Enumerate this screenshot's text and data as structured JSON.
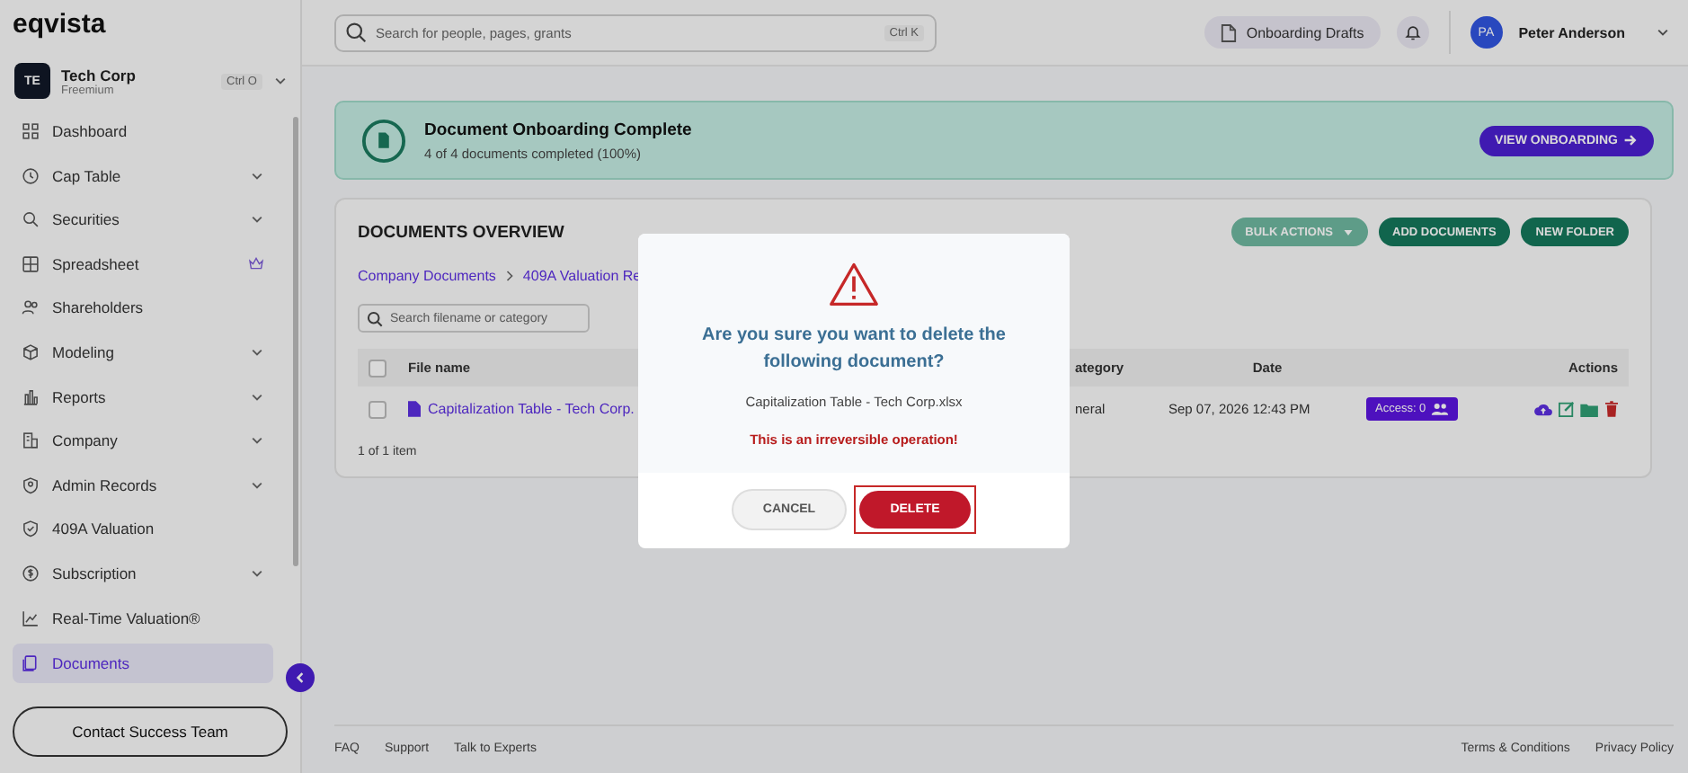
{
  "brand": "eqvista",
  "company": {
    "initials": "TE",
    "name": "Tech Corp",
    "plan": "Freemium",
    "shortcut": "Ctrl O"
  },
  "sidebar": {
    "items": [
      {
        "label": "Dashboard",
        "expandable": false,
        "premium": false,
        "selected": false
      },
      {
        "label": "Cap Table",
        "expandable": true,
        "premium": false,
        "selected": false
      },
      {
        "label": "Securities",
        "expandable": true,
        "premium": false,
        "selected": false
      },
      {
        "label": "Spreadsheet",
        "expandable": false,
        "premium": true,
        "selected": false
      },
      {
        "label": "Shareholders",
        "expandable": false,
        "premium": false,
        "selected": false
      },
      {
        "label": "Modeling",
        "expandable": true,
        "premium": false,
        "selected": false
      },
      {
        "label": "Reports",
        "expandable": true,
        "premium": false,
        "selected": false
      },
      {
        "label": "Company",
        "expandable": true,
        "premium": false,
        "selected": false
      },
      {
        "label": "Admin Records",
        "expandable": true,
        "premium": false,
        "selected": false
      },
      {
        "label": "409A Valuation",
        "expandable": false,
        "premium": false,
        "selected": false
      },
      {
        "label": "Subscription",
        "expandable": true,
        "premium": false,
        "selected": false
      },
      {
        "label": "Real-Time Valuation®",
        "expandable": false,
        "premium": false,
        "selected": false
      },
      {
        "label": "Documents",
        "expandable": false,
        "premium": false,
        "selected": true
      }
    ],
    "contact_button": "Contact Success Team"
  },
  "topbar": {
    "search": {
      "placeholder": "Search for people, pages, grants",
      "shortcut": "Ctrl K"
    },
    "drafts_button": "Onboarding Drafts",
    "user": {
      "initials": "PA",
      "name": "Peter Anderson"
    }
  },
  "banner": {
    "title": "Document Onboarding Complete",
    "subtitle": "4 of 4 documents completed (100%)",
    "button": "VIEW ONBOARDING"
  },
  "documents": {
    "title": "DOCUMENTS OVERVIEW",
    "buttons": [
      "BULK ACTIONS",
      "ADD DOCUMENTS",
      "NEW FOLDER"
    ],
    "breadcrumb": [
      "Company Documents",
      "409A Valuation Re"
    ],
    "search": {
      "placeholder": "Search filename or category"
    },
    "columns": [
      "File name",
      "ategory",
      "Date",
      "Actions"
    ],
    "all_checked": false,
    "rows": [
      {
        "checked": false,
        "file": "Capitalization Table - Tech Corp.",
        "category": "neral",
        "date": "Sep 07, 2026 12:43 PM",
        "access": "Access: 0"
      }
    ],
    "count": "1 of 1 item"
  },
  "footer": {
    "links": [
      "FAQ",
      "Support",
      "Talk to Experts"
    ],
    "right_links": [
      "Terms & Conditions",
      "Privacy Policy"
    ]
  },
  "dialog": {
    "question": "Are you sure you want to delete the following document?",
    "file": "Capitalization Table - Tech Corp.xlsx",
    "warning": "This is an irreversible operation!",
    "cancel": "CANCEL",
    "confirm": "DELETE"
  }
}
